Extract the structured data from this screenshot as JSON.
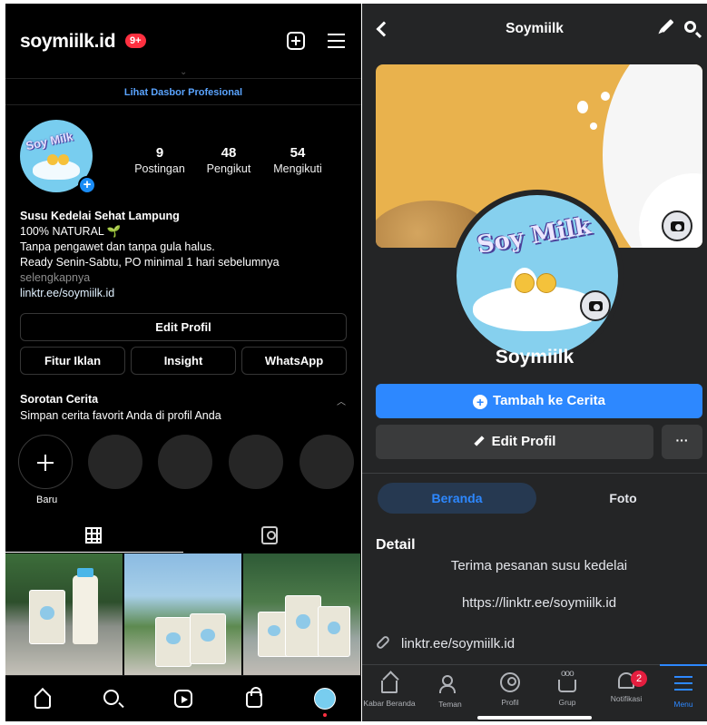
{
  "instagram": {
    "username": "soymiilk.id",
    "notif_badge": "9+",
    "dashboard_link": "Lihat Dasbor Profesional",
    "stats": [
      {
        "num": "9",
        "label": "Postingan"
      },
      {
        "num": "48",
        "label": "Pengikut"
      },
      {
        "num": "54",
        "label": "Mengikuti"
      }
    ],
    "bio": {
      "name": "Susu Kedelai Sehat Lampung",
      "line1": "100% NATURAL",
      "line2": "Tanpa pengawet dan tanpa gula halus.",
      "line3": "Ready Senin-Sabtu, PO minimal 1 hari sebelumnya",
      "more": "selengkapnya",
      "link": "linktr.ee/soymiilk.id"
    },
    "buttons": {
      "edit_profile": "Edit Profil",
      "ads": "Fitur Iklan",
      "insight": "Insight",
      "whatsapp": "WhatsApp"
    },
    "highlights": {
      "title": "Sorotan Cerita",
      "subtitle": "Simpan cerita favorit Anda di profil Anda",
      "new_label": "Baru"
    },
    "avatar_text": "Soy Milk",
    "icons": [
      "plus-square-icon",
      "menu-icon",
      "add-avatar-icon",
      "grid-icon",
      "tagged-icon",
      "home-icon",
      "search-icon",
      "reels-icon",
      "shop-icon"
    ]
  },
  "facebook": {
    "page_title": "Soymiilk",
    "profile_name": "Soymiilk",
    "avatar_text": "Soy Milk",
    "add_story": "Tambah ke Cerita",
    "edit_profile": "Edit Profil",
    "more": "···",
    "tabs": [
      "Beranda",
      "Foto"
    ],
    "detail": {
      "heading": "Detail",
      "line1": "Terima pesanan susu kedelai",
      "line2": "https://linktr.ee/soymiilk.id",
      "link": "linktr.ee/soymiilk.id"
    },
    "nav": [
      {
        "label": "Kabar Beranda",
        "icon": "home-icon"
      },
      {
        "label": "Teman",
        "icon": "friends-icon"
      },
      {
        "label": "Profil",
        "icon": "profile-icon"
      },
      {
        "label": "Grup",
        "icon": "groups-icon"
      },
      {
        "label": "Notifikasi",
        "icon": "bell-icon"
      },
      {
        "label": "Menu",
        "icon": "menu-icon"
      }
    ],
    "notif_count": "2",
    "colors": {
      "accent": "#2d88ff",
      "background": "#242526",
      "badge": "#e41e3f"
    }
  }
}
